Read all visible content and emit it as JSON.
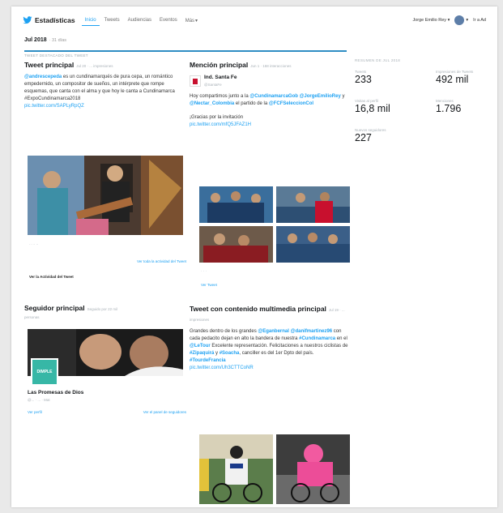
{
  "header": {
    "brand": "Estadísticas",
    "tabs": [
      "Inicio",
      "Tweets",
      "Audiencias",
      "Eventos",
      "Más"
    ],
    "user": "Jorge Emilio Rey",
    "right_label": "Ir a Ad"
  },
  "period": {
    "month": "Jul 2018",
    "days": "· 31 días"
  },
  "section_label": "TWEET DESTACADO DEL TWEET",
  "top_tweet": {
    "title": "Tweet principal",
    "meta": "Jul 20 · ... impresiones",
    "mention": "@andrescepeda",
    "text1": " es un cundinamarqués de pura cepa, un romántico empedernido, un compositor de sueños, un intérprete que rompe esquemas, que canta con el alma y que hoy le canta a Cundinamarca #ExpoCundinamarca2018",
    "link": "pic.twitter.com/SAPLyRpQZ",
    "stats": "·· ·· ··",
    "view_activity": "Ver toda la actividad del Tweet",
    "view_activity_bold": "Ver la Actividad del Tweet"
  },
  "top_mention": {
    "title": "Mención principal",
    "meta": "Jun 1 · 168 interacciones",
    "account": "Ind. Santa Fe",
    "account_handle": "@SantaFe",
    "text1": "Hoy compartimos junto a la ",
    "m1": "@CundinamarcaGob",
    "m2": "@JorgeEmilioRey",
    "text2": " y ",
    "m3": "@Nectar_Colombia",
    "text3": " el partido de la ",
    "m4": "@FCFSeleccionCol",
    "text4": "¡Gracias por la invitación",
    "link": "pic.twitter.com/mfQ5JFAZ1H",
    "view": "Ver Tweet"
  },
  "stats_panel": {
    "label": "RESUMEN DE JUL 2018",
    "tweets_label": "Tweets",
    "tweets": "233",
    "impressions_label": "Impresiones de Tweets",
    "impressions": "492 mil",
    "visits_label": "Visitas al perfil",
    "visits": "16,8 mil",
    "mentions_label": "Menciones",
    "mentions": "1.796",
    "followers_label": "Nuevos seguidores",
    "followers": "227"
  },
  "top_follower": {
    "title": "Seguidor principal",
    "meta": "Seguido por 22 mil",
    "sub": "personas",
    "logo_text": "DIMPLE",
    "name": "Las Promesas de Dios",
    "handle": "@... · ... · Mat",
    "view_profile": "Ver perfil",
    "view_followers": "Ver el panel de seguidores"
  },
  "media_tweet": {
    "title": "Tweet con contenido multimedia principal",
    "meta": "Jul 19 · ... impresiones",
    "t1": "Grandes dentro de los grandes ",
    "m1": "@Eganbernal",
    "m2": "@danifmartinez96",
    "t2": " con cada pedacito dejan en alto la bandera de nuestra ",
    "h1": "#Cundinamarca",
    "t3": " en el ",
    "m3": "@LeTour",
    "t4": " Excelente representación. Felicitaciones a nuestros ciclistas de ",
    "h2": "#Zipaquirá",
    "t5": " y ",
    "h3": "#Soacha",
    "t6": ", canciller es del 1er Dpto del país. ",
    "h4": "#TourdeFrancia",
    "link": "pic.twitter.com/Uh3CTTCoNR"
  },
  "colors": {
    "accent": "#1da1f2",
    "divider": "#2f8ec4"
  }
}
